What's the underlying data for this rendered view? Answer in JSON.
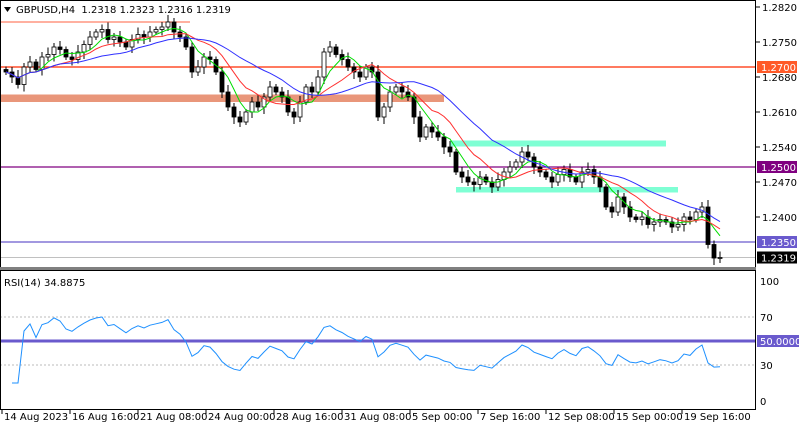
{
  "chart_data": {
    "type": "candlestick",
    "title": "GBPUSD,H4  1.2318 1.2323 1.2316 1.2319",
    "symbol": "GBPUSD,H4",
    "ohlc_last": {
      "open": "1.2318",
      "high": "1.2323",
      "low": "1.2316",
      "close": "1.2319"
    },
    "price_ylim": [
      1.23,
      1.2833
    ],
    "price_ticks": [
      "1.2820",
      "1.2750",
      "1.2680",
      "1.2610",
      "1.2540",
      "1.2470",
      "1.2400"
    ],
    "closes": [
      1.269,
      1.268,
      1.2665,
      1.27,
      1.271,
      1.2695,
      1.272,
      1.2725,
      1.274,
      1.2735,
      1.272,
      1.2715,
      1.273,
      1.2745,
      1.276,
      1.277,
      1.2775,
      1.2755,
      1.276,
      1.275,
      1.274,
      1.2755,
      1.2765,
      1.276,
      1.277,
      1.2775,
      1.278,
      1.279,
      1.277,
      1.276,
      1.274,
      1.269,
      1.27,
      1.272,
      1.2715,
      1.269,
      1.265,
      1.262,
      1.26,
      1.259,
      1.261,
      1.263,
      1.262,
      1.264,
      1.266,
      1.265,
      1.264,
      1.261,
      1.26,
      1.263,
      1.266,
      1.265,
      1.268,
      1.273,
      1.274,
      1.2725,
      1.2715,
      1.27,
      1.269,
      1.268,
      1.27,
      1.269,
      1.26,
      1.262,
      1.265,
      1.266,
      1.265,
      1.264,
      1.26,
      1.256,
      1.258,
      1.257,
      1.256,
      1.254,
      1.253,
      1.249,
      1.248,
      1.247,
      1.2465,
      1.248,
      1.247,
      1.246,
      1.2475,
      1.249,
      1.25,
      1.251,
      1.253,
      1.252,
      1.25,
      1.249,
      1.248,
      1.247,
      1.2485,
      1.2495,
      1.248,
      1.247,
      1.249,
      1.2495,
      1.248,
      1.246,
      1.242,
      1.241,
      1.244,
      1.242,
      1.24,
      1.2395,
      1.24,
      1.2385,
      1.239,
      1.2395,
      1.239,
      1.238,
      1.2385,
      1.24,
      1.2395,
      1.241,
      1.242,
      1.2345,
      1.2318,
      1.2319
    ],
    "moving_averages": [
      {
        "period": 5,
        "color": "#00dd00"
      },
      {
        "period": 10,
        "color": "#ff3030"
      },
      {
        "period": 20,
        "color": "#3030ff"
      }
    ],
    "hlines": [
      {
        "price": 1.27,
        "label": "1.2700",
        "color": "#ff2a00",
        "label_bg": "#ff5a28"
      },
      {
        "price": 1.25,
        "label": "1.2500",
        "color": "#800080",
        "label_bg": "#800080"
      },
      {
        "price": 1.235,
        "label": "1.2350",
        "color": "#6a5acd",
        "label_bg": "#6a5acd"
      }
    ],
    "current_price": {
      "price": 1.2319,
      "label": "1.2319",
      "label_bg": "#000000"
    },
    "top_line": {
      "price": 1.279,
      "color": "#ff6040"
    },
    "zones": [
      {
        "top": 1.2645,
        "bottom": 1.263,
        "from_index": 0,
        "to_index": 73,
        "color": "#e9967a"
      },
      {
        "top": 1.2553,
        "bottom": 1.2541,
        "from_index": 75,
        "to_index": 110,
        "color": "#7fffd4"
      },
      {
        "top": 1.246,
        "bottom": 1.2449,
        "from_index": 76,
        "to_index": 112,
        "color": "#7fffd4"
      }
    ],
    "rsi": {
      "label": "RSI(14) 34.8875",
      "period": 14,
      "ylim": [
        0,
        100
      ],
      "ticks": [
        "100",
        "70",
        "30",
        "0"
      ],
      "level": {
        "value": 50,
        "label": "50.0000",
        "color": "#6a5acd"
      },
      "dotted_levels": [
        70,
        30
      ],
      "line_color": "#1e90ff"
    },
    "time_labels": [
      "14 Aug 2023",
      "16 Aug 16:00",
      "21 Aug 08:00",
      "24 Aug 00:00",
      "28 Aug 16:00",
      "31 Aug 08:00",
      "5 Sep 00:00",
      "7 Sep 16:00",
      "12 Sep 08:00",
      "15 Sep 00:00",
      "19 Sep 16:00"
    ]
  }
}
